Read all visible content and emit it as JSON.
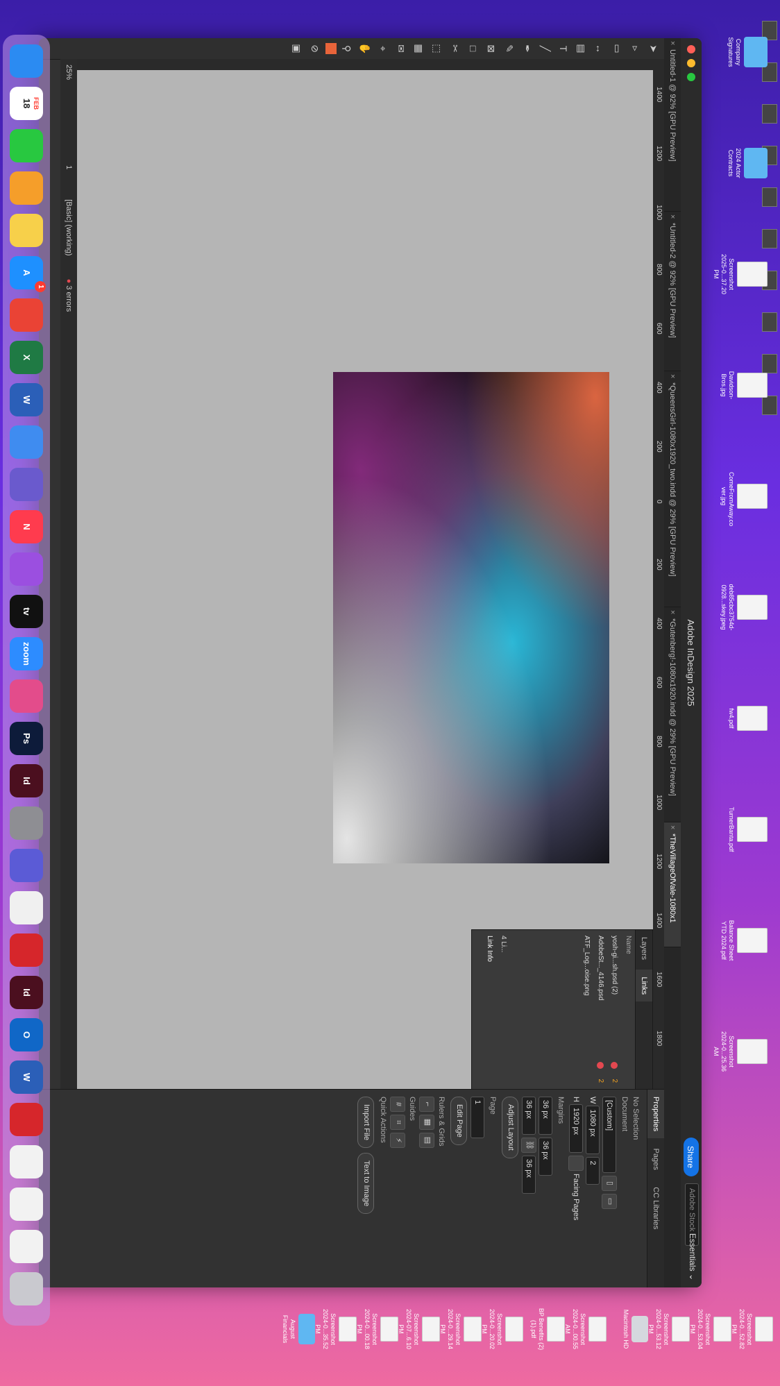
{
  "window": {
    "title": "Adobe InDesign 2025",
    "share_label": "Share",
    "workspace_label": "Essentials",
    "stock_placeholder": "Adobe Stock",
    "tabs": [
      {
        "label": "Untitled-1 @ 92% [GPU Preview]",
        "active": false
      },
      {
        "label": "*Untitled-2 @ 92% [GPU Preview]",
        "active": false
      },
      {
        "label": "*QueensGirl-1080x1920_two.indd @ 29% [GPU Preview]",
        "active": false
      },
      {
        "label": "*Gutenberg!-1080x1920.indd @ 29% [GPU Preview]",
        "active": false
      },
      {
        "label": "*TheVillageOfVale-1080x1",
        "active": true
      }
    ]
  },
  "ruler": {
    "ticks": [
      "1400",
      "1200",
      "1000",
      "800",
      "600",
      "400",
      "200",
      "0",
      "200",
      "400",
      "600",
      "800",
      "1000",
      "1200",
      "1400",
      "1600",
      "1800"
    ]
  },
  "status": {
    "zoom": "25%",
    "page": "1",
    "style": "[Basic] (working)",
    "errors": "3 errors"
  },
  "links_panel": {
    "tabs": [
      "Layers",
      "Links"
    ],
    "header": "Name",
    "rows": [
      {
        "name": "yosh-gi...sh.psd (2)",
        "badge": true,
        "count": "2"
      },
      {
        "name": "AdobeSt..._4146.psd",
        "badge": true,
        "count": "2"
      },
      {
        "name": "ATF_Log...oise.png",
        "badge": false,
        "count": ""
      }
    ],
    "footer_count": "4 Li...",
    "link_info": "Link Info"
  },
  "properties": {
    "tabs": [
      "Properties",
      "Pages",
      "CC Libraries"
    ],
    "no_selection": "No Selection",
    "document_label": "Document",
    "preset": "[Custom]",
    "w_label": "W",
    "w_value": "1080 px",
    "h_label": "H",
    "h_value": "1920 px",
    "pages_value": "2",
    "facing_pages": "Facing Pages",
    "margins_label": "Margins",
    "margin_values": [
      "36 px",
      "36 px",
      "36 px",
      "36 px"
    ],
    "adjust_layout": "Adjust Layout",
    "page_label": "Page",
    "page_value": "1",
    "edit_page": "Edit Page",
    "rulers_grids": "Rulers & Grids",
    "guides": "Guides",
    "quick_actions": "Quick Actions",
    "import_file": "Import File",
    "text_to_image": "Text to Image"
  },
  "desktop": {
    "right_icons": [
      {
        "label": "Company Signatures",
        "kind": "folder"
      },
      {
        "label": "2024 Actor Contracts",
        "kind": "folder"
      },
      {
        "label": "Screenshot 2025-0...37.20 PM",
        "kind": "thumb"
      },
      {
        "label": "Davidson-Bros.jpg",
        "kind": "thumb"
      },
      {
        "label": "ComeFromAway.co ver.jpg",
        "kind": "thumb"
      },
      {
        "label": "deb85cbc3754d-0928...skey.jpeg",
        "kind": "thumb"
      },
      {
        "label": "fw4.pdf",
        "kind": "thumb"
      },
      {
        "label": "TurnerBanta.pdf",
        "kind": "thumb"
      },
      {
        "label": "Balance Sheet YTD 2024.pdf",
        "kind": "thumb"
      },
      {
        "label": "Screenshot 2024-0...25.36 AM",
        "kind": "thumb"
      }
    ],
    "bottom_icons": [
      {
        "label": "Screenshot 2024-0...52.82 PM",
        "kind": "thumb"
      },
      {
        "label": "Screenshot 2024-0...53.04 PM",
        "kind": "thumb"
      },
      {
        "label": "Screenshot 2024-0...53.12 PM",
        "kind": "thumb"
      },
      {
        "label": "Macintosh HD",
        "kind": "drive"
      },
      {
        "label": "Screenshot 2024-0...00.55 AM",
        "kind": "thumb"
      },
      {
        "label": "BP Benefits (2) (1).pdf",
        "kind": "thumb"
      },
      {
        "label": "Screenshot 2024-0...20.02 PM",
        "kind": "thumb"
      },
      {
        "label": "Screenshot 2024-0...29.14 PM",
        "kind": "thumb"
      },
      {
        "label": "Screenshot 2024-07...6.10 PM",
        "kind": "thumb"
      },
      {
        "label": "Screenshot 2024-0...00.18 PM",
        "kind": "thumb"
      },
      {
        "label": "Screenshot 2024-0...35.52 PM",
        "kind": "thumb"
      },
      {
        "label": "August Financials",
        "kind": "folder"
      }
    ],
    "left_icons": [
      {
        "label": "k_Full_N..._P1.png"
      },
      {
        "label": "2025-0...4.14 PM"
      },
      {
        "label": "2025-02...4.26 AM"
      },
      {
        "label": "2025-0...16.32 PM"
      },
      {
        "label": "bistro-leroux.jpg"
      },
      {
        "label": "download (1).png"
      },
      {
        "label": "LogoHeader.png"
      },
      {
        "label": "fw9.pdf"
      },
      {
        "label": "10/31/24.pdf"
      },
      {
        "label": "2023.pdf"
      },
      {
        "label": "Financ..."
      }
    ]
  },
  "dock": {
    "calendar_month": "FEB",
    "calendar_day": "18",
    "appstore_badge": "1",
    "apps": [
      {
        "name": "finder",
        "text": "",
        "color": "#2b8bf2"
      },
      {
        "name": "calendar",
        "text": "18",
        "color": "#ffffff"
      },
      {
        "name": "numbers",
        "text": "",
        "color": "#28c840"
      },
      {
        "name": "pages",
        "text": "",
        "color": "#f59e2a"
      },
      {
        "name": "notes",
        "text": "",
        "color": "#f7d04a"
      },
      {
        "name": "app-store",
        "text": "A",
        "color": "#1e90ff"
      },
      {
        "name": "chrome",
        "text": "",
        "color": "#ea4335"
      },
      {
        "name": "excel",
        "text": "X",
        "color": "#1f7a44"
      },
      {
        "name": "word",
        "text": "W",
        "color": "#2b5fb8"
      },
      {
        "name": "keynote",
        "text": "",
        "color": "#3f8cf0"
      },
      {
        "name": "preview",
        "text": "",
        "color": "#6a5acd"
      },
      {
        "name": "news",
        "text": "N",
        "color": "#ff3b4e"
      },
      {
        "name": "podcasts",
        "text": "",
        "color": "#9b4fe0"
      },
      {
        "name": "apple-tv",
        "text": "tv",
        "color": "#111111"
      },
      {
        "name": "zoom",
        "text": "zoom",
        "color": "#2d8cff"
      },
      {
        "name": "creative-cloud",
        "text": "",
        "color": "#e34c8b"
      },
      {
        "name": "photoshop",
        "text": "Ps",
        "color": "#0d1b3a"
      },
      {
        "name": "indesign",
        "text": "Id",
        "color": "#4b0f1f"
      },
      {
        "name": "system-settings",
        "text": "",
        "color": "#8e8e93"
      },
      {
        "name": "screen-share",
        "text": "",
        "color": "#5b5bd6"
      },
      {
        "name": "freeform",
        "text": "",
        "color": "#f0f0f0"
      },
      {
        "name": "acrobat",
        "text": "",
        "color": "#d6262b"
      },
      {
        "name": "indesign-2",
        "text": "Id",
        "color": "#4b0f1f"
      },
      {
        "name": "outlook",
        "text": "O",
        "color": "#1067c7"
      },
      {
        "name": "word-doc",
        "text": "W",
        "color": "#2b5fb8"
      },
      {
        "name": "acrobat-doc",
        "text": "",
        "color": "#d6262b"
      },
      {
        "name": "doc-1",
        "text": "",
        "color": "#f2f2f2"
      },
      {
        "name": "doc-2",
        "text": "",
        "color": "#f2f2f2"
      },
      {
        "name": "doc-3",
        "text": "",
        "color": "#f2f2f2"
      },
      {
        "name": "trash",
        "text": "",
        "color": "#c9c9cf"
      }
    ]
  }
}
